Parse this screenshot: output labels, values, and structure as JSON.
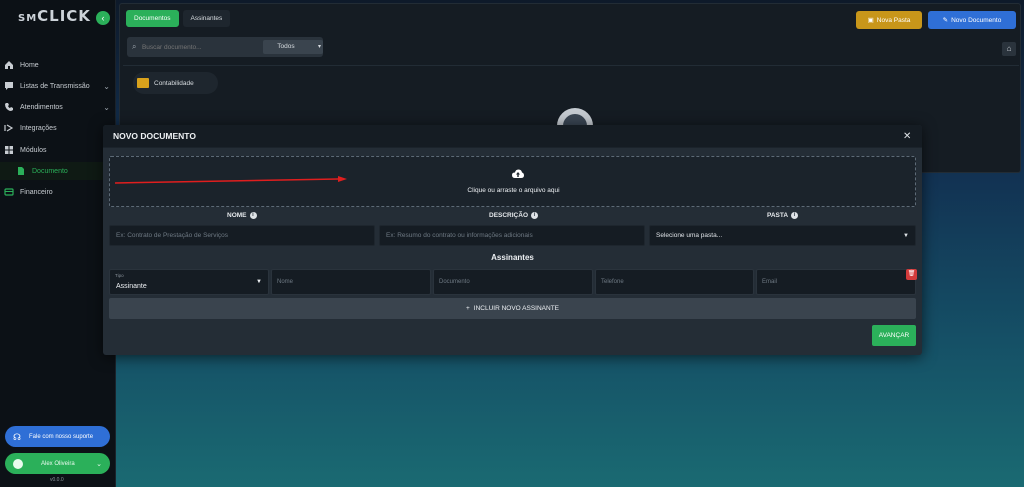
{
  "sidebar": {
    "logo_part1": "SM",
    "logo_part2": "CLICK",
    "items": [
      {
        "label": "Home",
        "icon": "home-icon"
      },
      {
        "label": "Listas de Transmissão",
        "icon": "chat-icon"
      },
      {
        "label": "Atendimentos",
        "icon": "phone-icon"
      },
      {
        "label": "Integrações",
        "icon": "plug-icon"
      },
      {
        "label": "Módulos",
        "icon": "grid-icon"
      },
      {
        "label": "Documento",
        "icon": "document-icon"
      },
      {
        "label": "Financeiro",
        "icon": "finance-icon"
      }
    ],
    "support_label": "Fale com nosso suporte",
    "user_label": "Alex Oliveira",
    "version": "v0.0.0"
  },
  "main": {
    "tabs": [
      {
        "label": "Documentos"
      },
      {
        "label": "Assinantes"
      }
    ],
    "new_folder_label": "Nova Pasta",
    "new_document_label": "Novo Documento",
    "search": {
      "placeholder": "Buscar documento...",
      "filter_value": "Todos"
    },
    "folder_label": "Contabilidade"
  },
  "modal": {
    "title": "NOVO DOCUMENTO",
    "dropzone_text": "Clique ou arraste o arquivo aqui",
    "fields": {
      "name_label": "NOME",
      "name_placeholder": "Ex: Contrato de Prestação de Serviços",
      "description_label": "DESCRIÇÃO",
      "description_placeholder": "Ex: Resumo do contrato ou informações adicionais",
      "folder_label": "PASTA",
      "folder_value": "Selecione uma pasta..."
    },
    "signers_title": "Assinantes",
    "signer": {
      "type_label": "Tipo",
      "type_value": "Assinante",
      "name_placeholder": "Nome",
      "document_placeholder": "Documento",
      "phone_placeholder": "Telefone",
      "email_placeholder": "Email"
    },
    "add_signer_label": "INCLUIR NOVO ASSINANTE",
    "next_label": "AVANÇAR"
  },
  "colors": {
    "accent": "#2bb05a",
    "blue": "#2f6fd6",
    "folder": "#c8961a",
    "danger": "#d33b3b",
    "arrow": "#e01e1e"
  }
}
